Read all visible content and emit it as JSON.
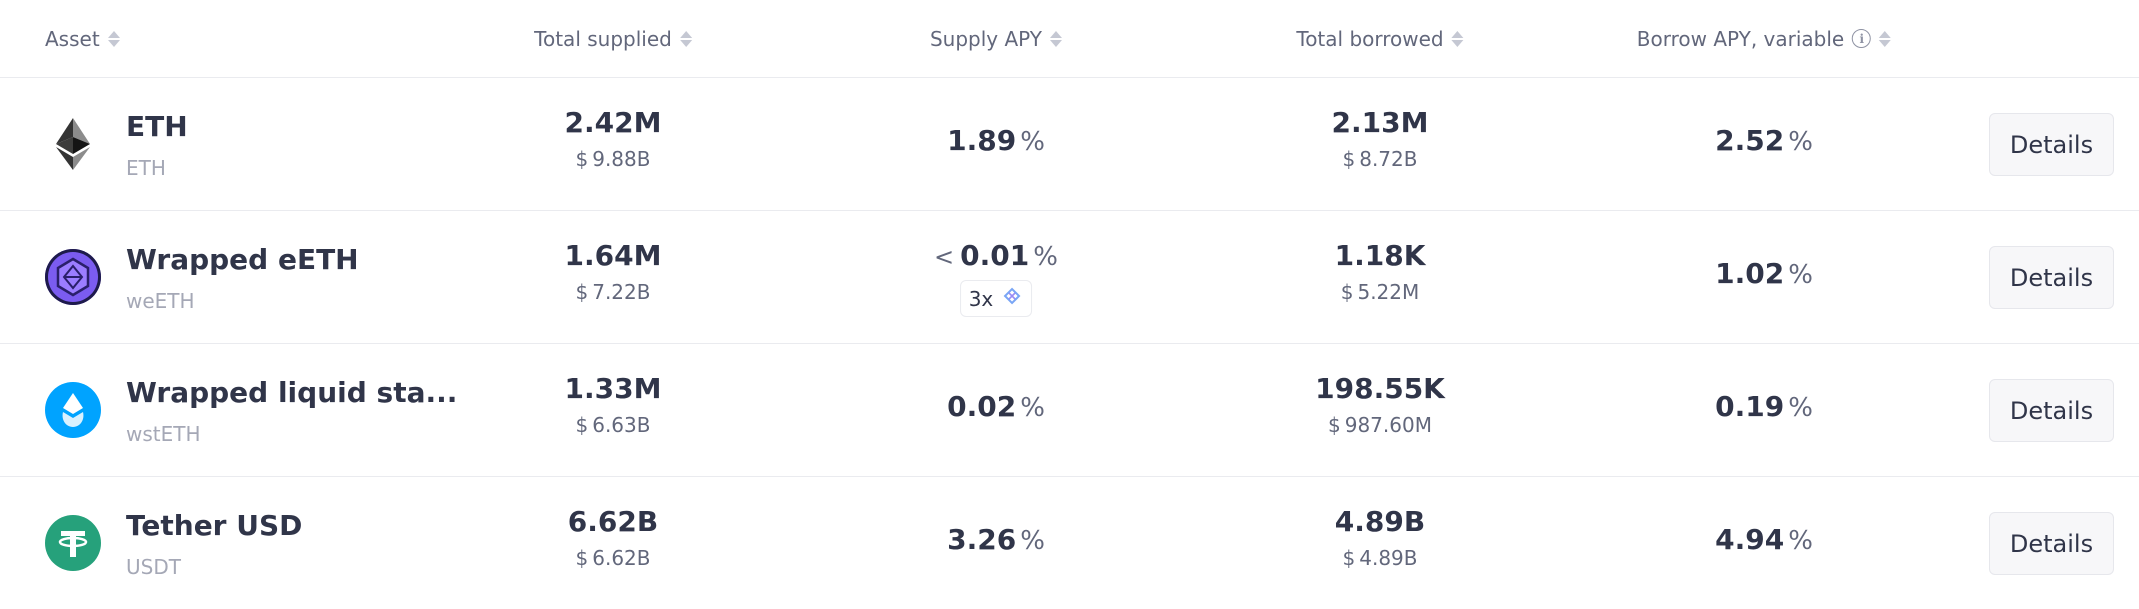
{
  "header": {
    "asset": "Asset",
    "total_supplied": "Total supplied",
    "supply_apy": "Supply APY",
    "total_borrowed": "Total borrowed",
    "borrow_apy": "Borrow APY, variable"
  },
  "details_label": "Details",
  "currency_symbol": "$",
  "percent_symbol": "%",
  "less_than_symbol": "<",
  "rows": [
    {
      "name": "ETH",
      "symbol": "ETH",
      "icon": "eth-icon",
      "total_supplied": "2.42M",
      "total_supplied_usd": "9.88B",
      "supply_apy": "1.89",
      "total_borrowed": "2.13M",
      "total_borrowed_usd": "8.72B",
      "borrow_apy": "2.52"
    },
    {
      "name": "Wrapped eETH",
      "symbol": "weETH",
      "icon": "weeth-icon",
      "total_supplied": "1.64M",
      "total_supplied_usd": "7.22B",
      "supply_apy": "0.01",
      "boost": "3x",
      "total_borrowed": "1.18K",
      "total_borrowed_usd": "5.22M",
      "borrow_apy": "1.02"
    },
    {
      "name": "Wrapped liquid sta...",
      "symbol": "wstETH",
      "icon": "wsteth-icon",
      "total_supplied": "1.33M",
      "total_supplied_usd": "6.63B",
      "supply_apy": "0.02",
      "total_borrowed": "198.55K",
      "total_borrowed_usd": "987.60M",
      "borrow_apy": "0.19"
    },
    {
      "name": "Tether USD",
      "symbol": "USDT",
      "icon": "tether-icon",
      "total_supplied": "6.62B",
      "total_supplied_usd": "6.62B",
      "supply_apy": "3.26",
      "total_borrowed": "4.89B",
      "total_borrowed_usd": "4.89B",
      "borrow_apy": "4.94"
    }
  ],
  "colors": {
    "text_primary": "#303549",
    "text_secondary": "#62677b",
    "text_muted": "#a5a8b6",
    "tether_green": "#26a17b",
    "wsteth_blue": "#00a3ff",
    "weeth_purple": "#7b5cf0"
  }
}
